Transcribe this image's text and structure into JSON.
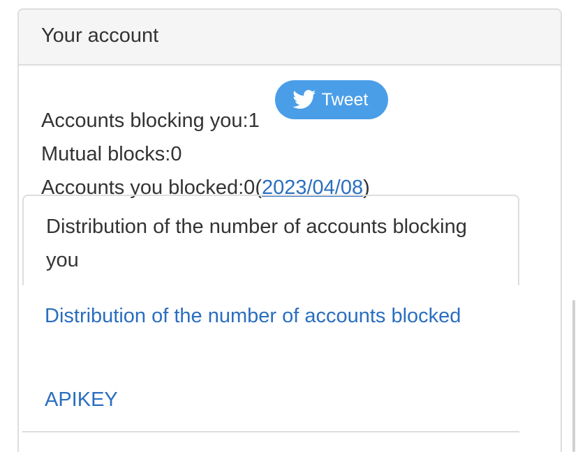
{
  "panel": {
    "title": "Your account"
  },
  "stats": {
    "blocking_you_label": "Accounts blocking you:",
    "blocking_you_value": "1",
    "mutual_label": "Mutual blocks:",
    "mutual_value": "0",
    "you_blocked_label": "Accounts you blocked:",
    "you_blocked_value": "0",
    "open_paren": "(",
    "date": "2023/04/08",
    "close_paren": ")"
  },
  "tweet_button": {
    "label": "Tweet",
    "icon": "twitter-bird-icon",
    "color": "#4a9ee8"
  },
  "menu": {
    "active": "Distribution of the number of accounts blocking you",
    "items": [
      "Distribution of the number of accounts blocked",
      "APIKEY"
    ]
  },
  "colors": {
    "link": "#2a6ebf",
    "text": "#333333",
    "heading_bg": "#f5f5f5",
    "border": "#dddddd"
  }
}
